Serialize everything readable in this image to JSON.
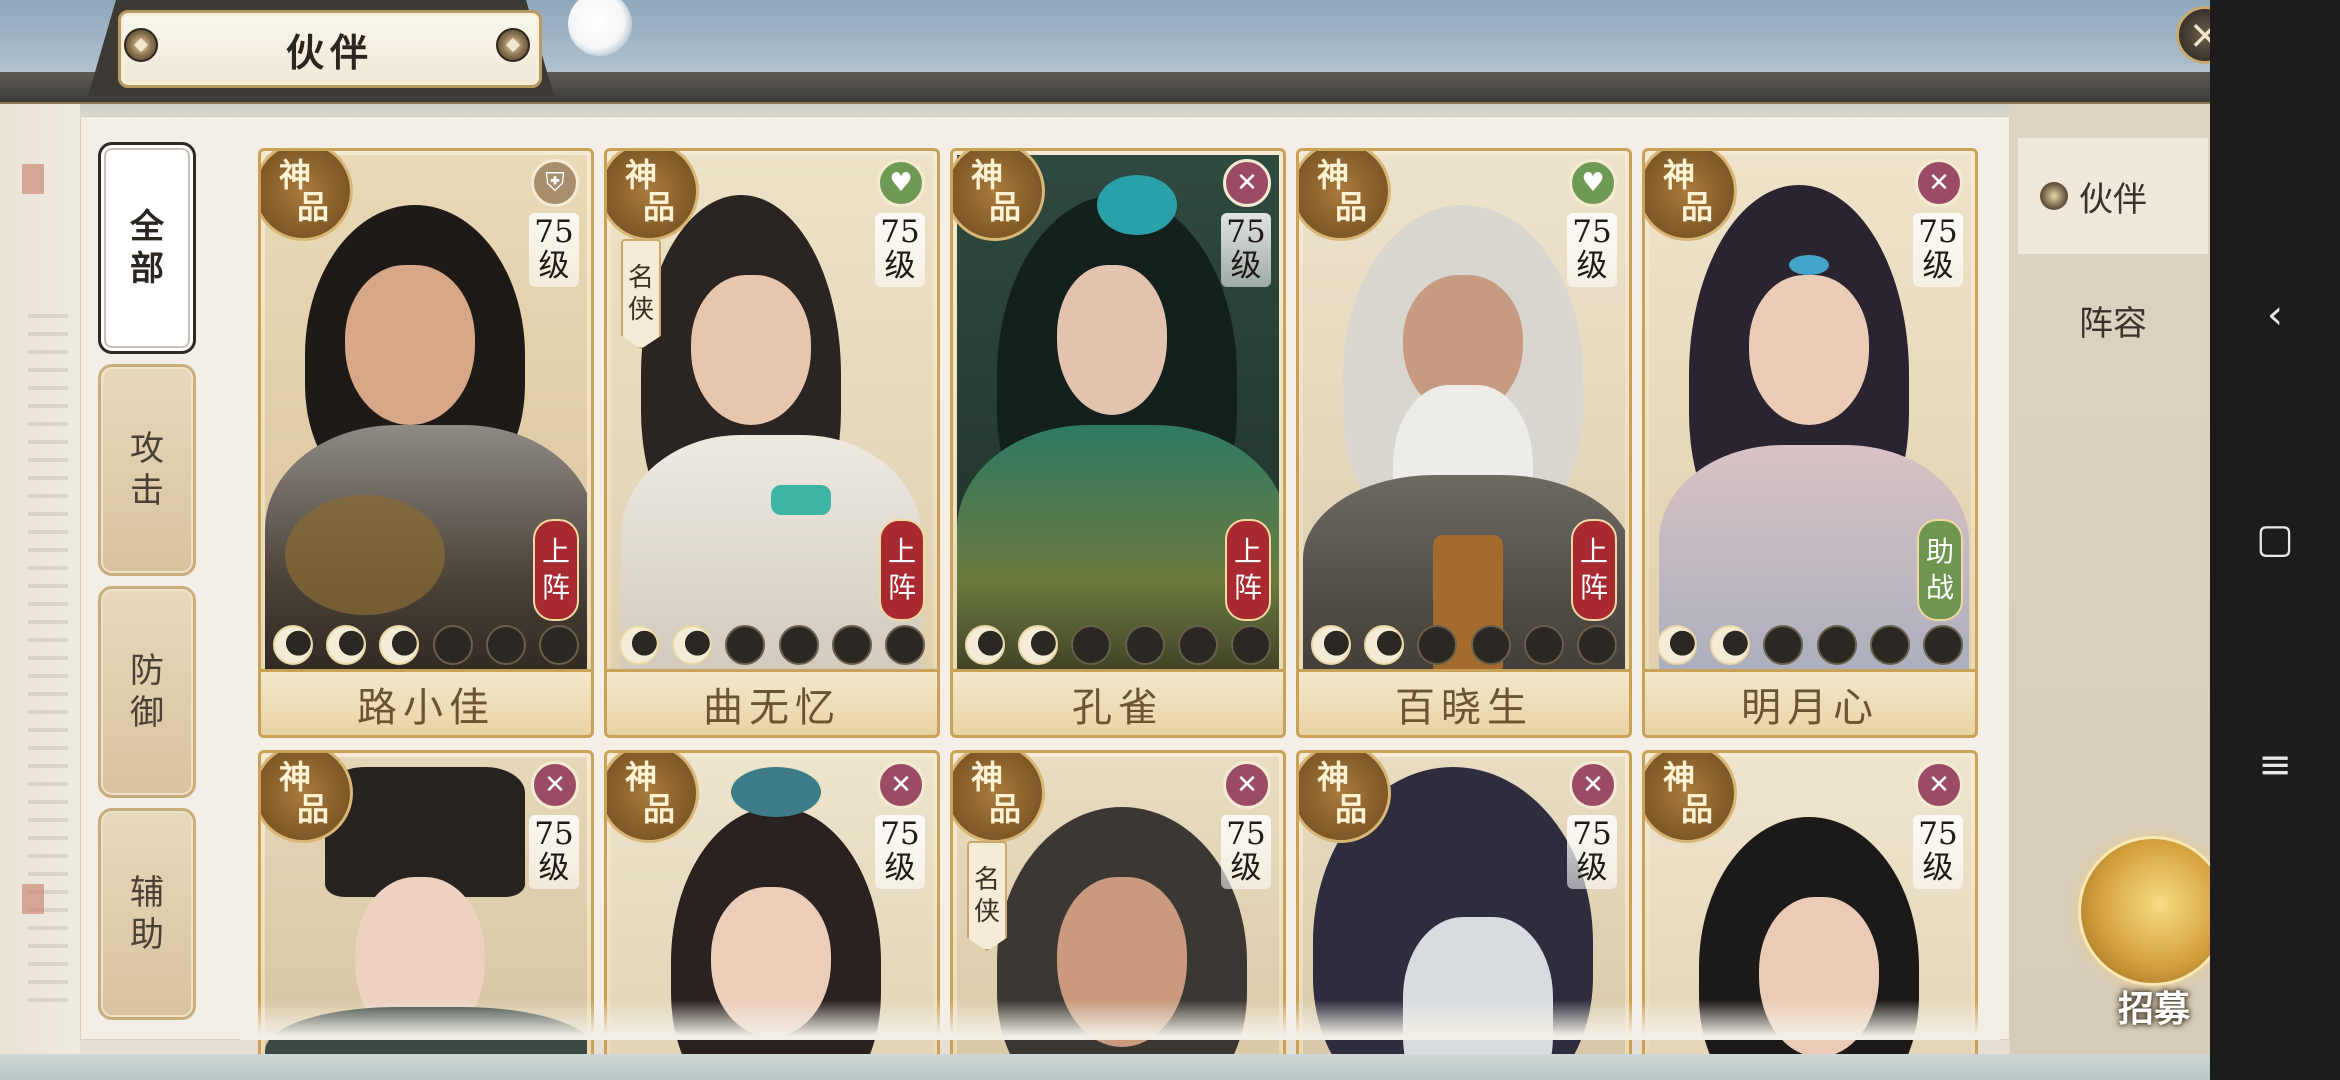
{
  "window": {
    "title": "伙伴",
    "close_icon": "×"
  },
  "filters": [
    {
      "label_top": "全",
      "label_bottom": "部",
      "active": true
    },
    {
      "label_top": "攻",
      "label_bottom": "击",
      "active": false
    },
    {
      "label_top": "防",
      "label_bottom": "御",
      "active": false
    },
    {
      "label_top": "辅",
      "label_bottom": "助",
      "active": false
    }
  ],
  "grade": {
    "top": "神",
    "bottom": "品"
  },
  "level_unit": "级",
  "famous": {
    "top": "名",
    "bottom": "侠"
  },
  "status": {
    "on_top": "上",
    "on_bottom": "阵",
    "assist_top": "助",
    "assist_bottom": "战"
  },
  "partners": [
    {
      "name": "路小佳",
      "level": "75",
      "role": "shield",
      "status": "上阵",
      "stars_lit": 3,
      "stars_total": 6
    },
    {
      "name": "曲无忆",
      "level": "75",
      "role": "heart",
      "status": "上阵",
      "famous": true,
      "stars_lit": 2,
      "stars_total": 6
    },
    {
      "name": "孔雀",
      "level": "75",
      "role": "sword",
      "status": "上阵",
      "stars_lit": 2,
      "stars_total": 6
    },
    {
      "name": "百晓生",
      "level": "75",
      "role": "heart",
      "status": "上阵",
      "stars_lit": 2,
      "stars_total": 6
    },
    {
      "name": "明月心",
      "level": "75",
      "role": "sword",
      "status": "助战",
      "stars_lit": 2,
      "stars_total": 6
    },
    {
      "level": "75",
      "role": "sword"
    },
    {
      "level": "75",
      "role": "sword"
    },
    {
      "level": "75",
      "role": "sword",
      "famous": true
    },
    {
      "level": "75",
      "role": "sword"
    },
    {
      "level": "75",
      "role": "sword"
    }
  ],
  "side_tabs": {
    "partner": "伙伴",
    "lineup": "阵容"
  },
  "recruit": {
    "label": "招募"
  },
  "system_nav": {
    "back": "‹",
    "home": "▢",
    "menu": "≡"
  },
  "colors": {
    "gold_border": "#c9a258",
    "status_red": "#a82a30",
    "assist_green": "#6e9651",
    "role_sword": "#9c4b66",
    "role_heart": "#6f9a55",
    "role_shield": "#a88f6c"
  }
}
